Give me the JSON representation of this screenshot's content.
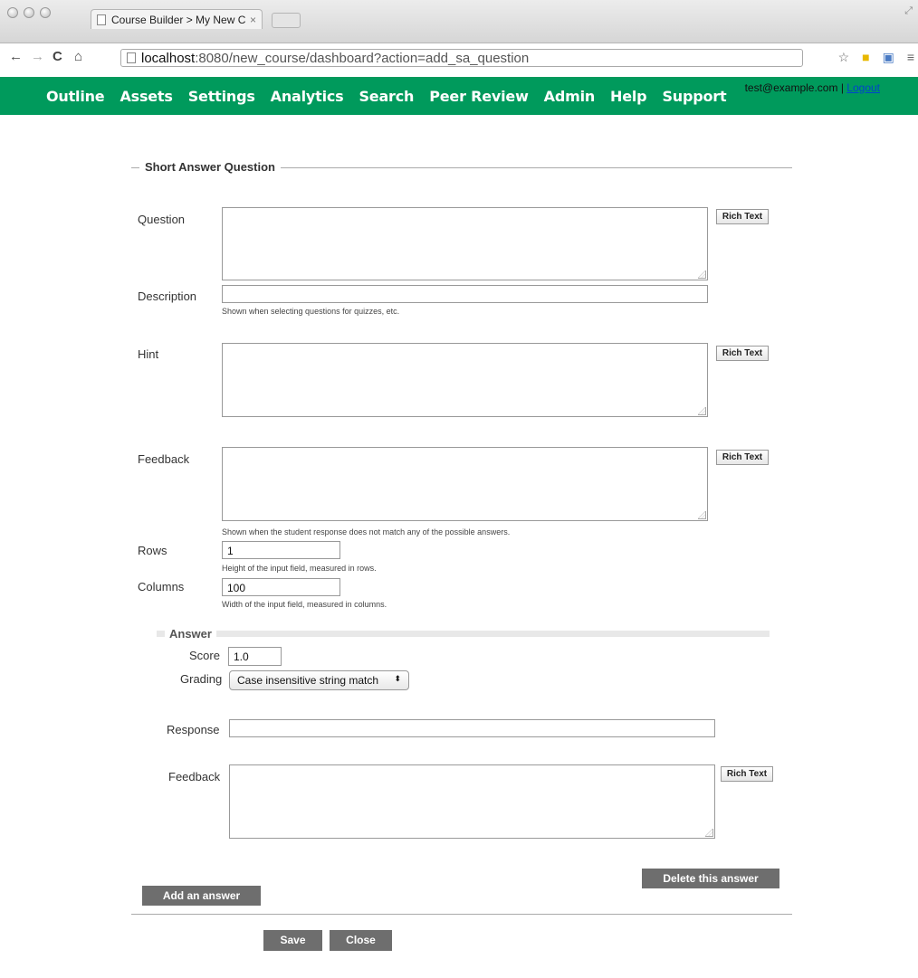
{
  "browser": {
    "tab_title": "Course Builder > My New C",
    "tab_close": "×",
    "url_host": "localhost",
    "url_path": ":8080/new_course/dashboard?action=add_sa_question"
  },
  "nav": {
    "items": [
      "Outline",
      "Assets",
      "Settings",
      "Analytics",
      "Search",
      "Peer Review",
      "Admin",
      "Help",
      "Support"
    ],
    "user_email": "test@example.com",
    "separator": "|",
    "logout": "Logout"
  },
  "form": {
    "legend": "Short Answer Question",
    "question_label": "Question",
    "description_label": "Description",
    "description_value": "",
    "description_help": "Shown when selecting questions for quizzes, etc.",
    "hint_label": "Hint",
    "feedback_label": "Feedback",
    "feedback_help": "Shown when the student response does not match any of the possible answers.",
    "rows_label": "Rows",
    "rows_value": "1",
    "rows_help": "Height of the input field, measured in rows.",
    "columns_label": "Columns",
    "columns_value": "100",
    "columns_help": "Width of the input field, measured in columns.",
    "rich_text": "Rich Text"
  },
  "answer": {
    "legend": "Answer",
    "score_label": "Score",
    "score_value": "1.0",
    "grading_label": "Grading",
    "grading_value": "Case insensitive string match",
    "response_label": "Response",
    "response_value": "",
    "feedback_label": "Feedback",
    "delete_button": "Delete this answer"
  },
  "actions": {
    "add_answer": "Add an answer",
    "save": "Save",
    "close": "Close"
  },
  "colors": {
    "nav_green": "#009a5c",
    "button_gray": "#6e6e6e"
  }
}
